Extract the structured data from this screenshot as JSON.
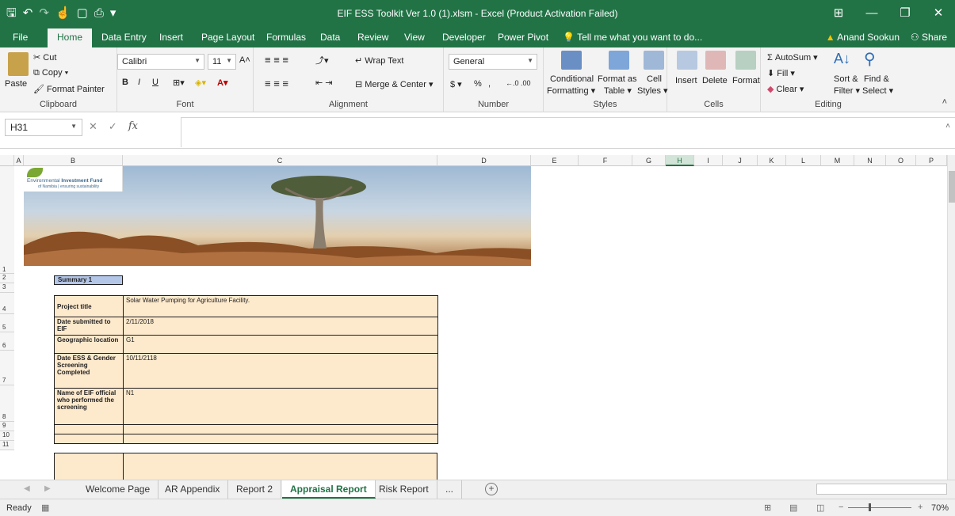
{
  "window": {
    "title": "EIF ESS Toolkit Ver 1.0 (1).xlsm - Excel (Product Activation Failed)",
    "minimize": "—",
    "restore": "❐",
    "close": "✕",
    "ribbon_display": "⊞"
  },
  "quick_access": [
    "save",
    "undo",
    "redo",
    "touch-mode",
    "new",
    "print-preview",
    "customize"
  ],
  "menu": {
    "tabs": [
      "File",
      "Home",
      "Data Entry",
      "Insert",
      "Page Layout",
      "Formulas",
      "Data",
      "Review",
      "View",
      "Developer",
      "Power Pivot"
    ],
    "active": "Home",
    "tell_me": "Tell me what you want to do...",
    "user": "Anand Sookun",
    "share": "Share"
  },
  "ribbon": {
    "clipboard": {
      "paste": "Paste",
      "cut": "Cut",
      "copy": "Copy",
      "format_painter": "Format Painter",
      "label": "Clipboard"
    },
    "font": {
      "name": "Calibri",
      "size": "11",
      "bold": "B",
      "italic": "I",
      "underline": "U",
      "label": "Font"
    },
    "alignment": {
      "wrap": "Wrap Text",
      "merge": "Merge & Center",
      "label": "Alignment"
    },
    "number": {
      "format": "General",
      "currency": "$",
      "percent": "%",
      "comma": ",",
      "label": "Number"
    },
    "styles": {
      "conditional": "Conditional",
      "conditional2": "Formatting",
      "format_as": "Format as",
      "format_as2": "Table",
      "cell": "Cell",
      "cell2": "Styles",
      "label": "Styles"
    },
    "cells": {
      "insert": "Insert",
      "delete": "Delete",
      "format": "Format",
      "label": "Cells"
    },
    "editing": {
      "autosum": "AutoSum",
      "fill": "Fill",
      "clear": "Clear",
      "sort": "Sort &",
      "sort2": "Filter",
      "find": "Find &",
      "find2": "Select",
      "label": "Editing"
    }
  },
  "formula_bar": {
    "name_box": "H31",
    "fx": "fx",
    "value": ""
  },
  "columns": [
    "A",
    "B",
    "C",
    "D",
    "E",
    "F",
    "G",
    "H",
    "I",
    "J",
    "K",
    "L",
    "M",
    "N",
    "O",
    "P"
  ],
  "selected_column": "H",
  "rows": [
    "1",
    "2",
    "3",
    "4",
    "5",
    "6",
    "7",
    "8",
    "9",
    "10",
    "11"
  ],
  "logo": {
    "line1_a": "Environmental ",
    "line1_b": "Investment Fund",
    "line2": "of Namibia | ensuring sustainability"
  },
  "sheet": {
    "summary_label": "Summary 1",
    "project_rows": [
      {
        "key": "Project title",
        "value": "Solar Water Pumping for Agriculture Facility."
      },
      {
        "key": "Date submitted to EIF",
        "value": "2/11/2018"
      },
      {
        "key": "Geographic location",
        "value": "G1"
      },
      {
        "key": "Date ESS & Gender Screening Completed",
        "value": "10/11/2118"
      },
      {
        "key": "Name of EIF official who performed the screening",
        "value": "N1"
      },
      {
        "key": "",
        "value": ""
      },
      {
        "key": "",
        "value": ""
      }
    ]
  },
  "sheet_tabs": [
    "Welcome Page",
    "AR Appendix",
    "Report 2",
    "Appraisal Report",
    "Risk Report",
    "..."
  ],
  "active_sheet": "Appraisal Report",
  "status": {
    "ready": "Ready",
    "zoom": "70%"
  }
}
